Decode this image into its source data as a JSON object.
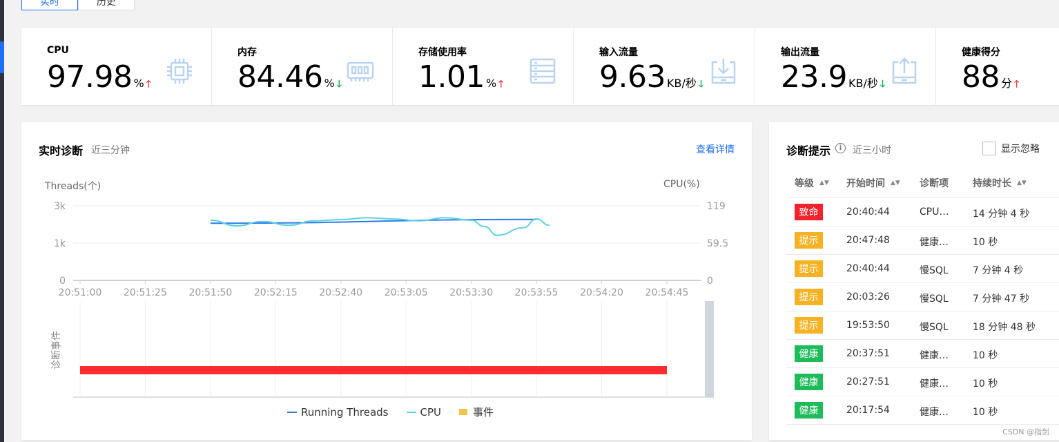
{
  "mode_tabs": [
    {
      "label": "实时",
      "active": true
    },
    {
      "label": "历史",
      "active": false
    }
  ],
  "metrics": [
    {
      "label": "CPU",
      "value": "97.98",
      "unit": "%",
      "trend": "up",
      "icon": "cpu-icon"
    },
    {
      "label": "内存",
      "value": "84.46",
      "unit": "%",
      "trend": "down",
      "icon": "memory-icon"
    },
    {
      "label": "存储使用率",
      "value": "1.01",
      "unit": "%",
      "trend": "up",
      "icon": "storage-icon"
    },
    {
      "label": "输入流量",
      "value": "9.63",
      "unit": "KB/秒",
      "trend": "down",
      "icon": "download-icon"
    },
    {
      "label": "输出流量",
      "value": "23.9",
      "unit": "KB/秒",
      "trend": "down",
      "icon": "upload-icon"
    },
    {
      "label": "健康得分",
      "value": "88",
      "unit": "分",
      "trend": "up",
      "icon": "health-icon"
    }
  ],
  "diagnosis": {
    "title": "实时诊断",
    "subtitle": "近三分钟",
    "detail_link": "查看详情",
    "event_axis_label": "诊断事件"
  },
  "chart_data": {
    "type": "line",
    "x": [
      "20:51:00",
      "20:51:25",
      "20:51:50",
      "20:52:15",
      "20:52:40",
      "20:53:05",
      "20:53:30",
      "20:53:55",
      "20:54:20",
      "20:54:45"
    ],
    "ylabel": "Threads(个)",
    "ylabel_right": "CPU(%)",
    "y_ticks": [
      "0",
      "1k",
      "3k"
    ],
    "y_right_ticks": [
      "0",
      "59.5",
      "119"
    ],
    "ylim": [
      0,
      3000
    ],
    "ylim_right": [
      0,
      119
    ],
    "legend": [
      "Running Threads",
      "CPU",
      "事件"
    ],
    "colors": {
      "threads": "#2b7ce9",
      "cpu": "#5cd0df",
      "event": "#f5c342",
      "event_bar": "#ff2d2d"
    },
    "series": [
      {
        "name": "Running Threads",
        "axis": "left",
        "points": [
          [
            "20:51:50",
            2300
          ],
          [
            "20:53:55",
            2450
          ]
        ]
      },
      {
        "name": "CPU",
        "axis": "right",
        "points": [
          [
            "20:51:50",
            96
          ],
          [
            "20:52:00",
            87
          ],
          [
            "20:52:10",
            94
          ],
          [
            "20:52:20",
            88
          ],
          [
            "20:52:30",
            95
          ],
          [
            "20:52:40",
            97
          ],
          [
            "20:52:50",
            100
          ],
          [
            "20:53:00",
            98
          ],
          [
            "20:53:10",
            95
          ],
          [
            "20:53:20",
            100
          ],
          [
            "20:53:30",
            96
          ],
          [
            "20:53:35",
            86
          ],
          [
            "20:53:40",
            72
          ],
          [
            "20:53:50",
            84
          ],
          [
            "20:53:55",
            98
          ],
          [
            "20:54:00",
            88
          ]
        ]
      }
    ],
    "events": [
      {
        "start": "20:51:00",
        "end": "20:54:45",
        "level": "致命"
      }
    ]
  },
  "tips": {
    "title": "诊断提示",
    "subtitle": "近三小时",
    "ignore_label": "显示忽略",
    "columns": [
      "等级",
      "开始时间",
      "诊断项",
      "持续时长"
    ],
    "level_colors": {
      "致命": "#f5222d",
      "提示": "#f5b324",
      "健康": "#1dbb59"
    },
    "rows": [
      {
        "level": "致命",
        "start": "20:40:44",
        "item": "CPU…",
        "duration": "14 分钟 4 秒"
      },
      {
        "level": "提示",
        "start": "20:47:48",
        "item": "健康…",
        "duration": "10 秒"
      },
      {
        "level": "提示",
        "start": "20:40:44",
        "item": "慢SQL",
        "duration": "7 分钟 4 秒"
      },
      {
        "level": "提示",
        "start": "20:03:26",
        "item": "慢SQL",
        "duration": "7 分钟 47 秒"
      },
      {
        "level": "提示",
        "start": "19:53:50",
        "item": "慢SQL",
        "duration": "18 分钟 48 秒"
      },
      {
        "level": "健康",
        "start": "20:37:51",
        "item": "健康…",
        "duration": "10 秒"
      },
      {
        "level": "健康",
        "start": "20:27:51",
        "item": "健康…",
        "duration": "10 秒"
      },
      {
        "level": "健康",
        "start": "20:17:54",
        "item": "健康…",
        "duration": "10 秒"
      }
    ]
  },
  "watermark": "CSDN @指剑"
}
